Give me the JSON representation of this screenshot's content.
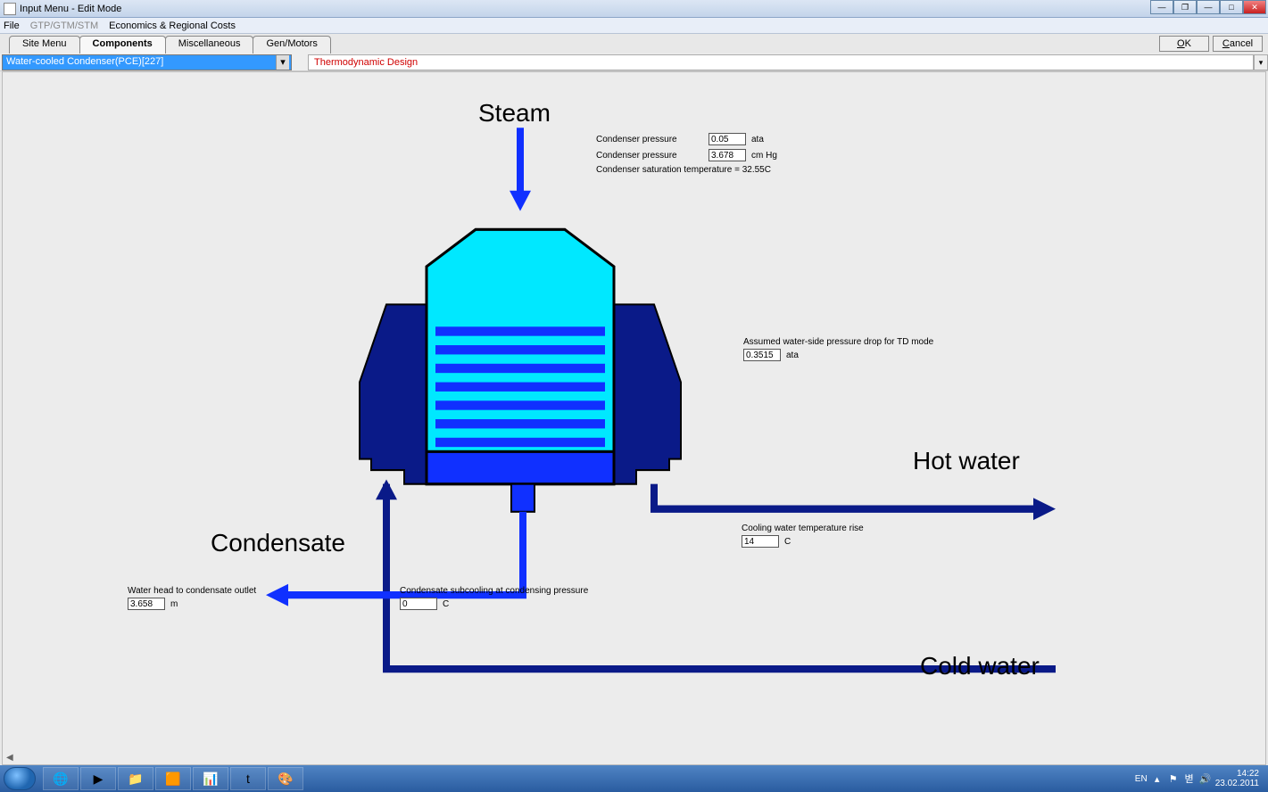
{
  "window": {
    "title": "Input Menu - Edit Mode"
  },
  "menu": {
    "file": "File",
    "gtp": "GTP/GTM/STM",
    "econ": "Economics & Regional Costs"
  },
  "tabs": {
    "site": "Site Menu",
    "components": "Components",
    "misc": "Miscellaneous",
    "genmotors": "Gen/Motors"
  },
  "dlg": {
    "ok": "OK",
    "cancel": "Cancel"
  },
  "combo": {
    "selected": "Water-cooled Condenser(PCE)[227]"
  },
  "design": {
    "label": "Thermodynamic Design"
  },
  "labels": {
    "steam": "Steam",
    "condensate": "Condensate",
    "hotwater": "Hot water",
    "coldwater": "Cold water"
  },
  "params": {
    "cond_pressure_ata": {
      "label": "Condenser pressure",
      "value": "0.05",
      "unit": "ata"
    },
    "cond_pressure_cmhg": {
      "label": "Condenser pressure",
      "value": "3.678",
      "unit": "cm Hg"
    },
    "saturation": "Condenser saturation temperature = 32.55C",
    "assumed_drop": {
      "label": "Assumed water-side pressure drop for TD mode",
      "value": "0.3515",
      "unit": "ata"
    },
    "cw_rise": {
      "label": "Cooling water temperature rise",
      "value": "14",
      "unit": "C"
    },
    "water_head": {
      "label": "Water head to condensate outlet",
      "value": "3.658",
      "unit": "m"
    },
    "subcooling": {
      "label": "Condensate subcooling at condensing pressure",
      "value": "0",
      "unit": "C"
    }
  },
  "tray": {
    "lang": "EN",
    "time": "14:22",
    "date": "23.02.2011"
  }
}
